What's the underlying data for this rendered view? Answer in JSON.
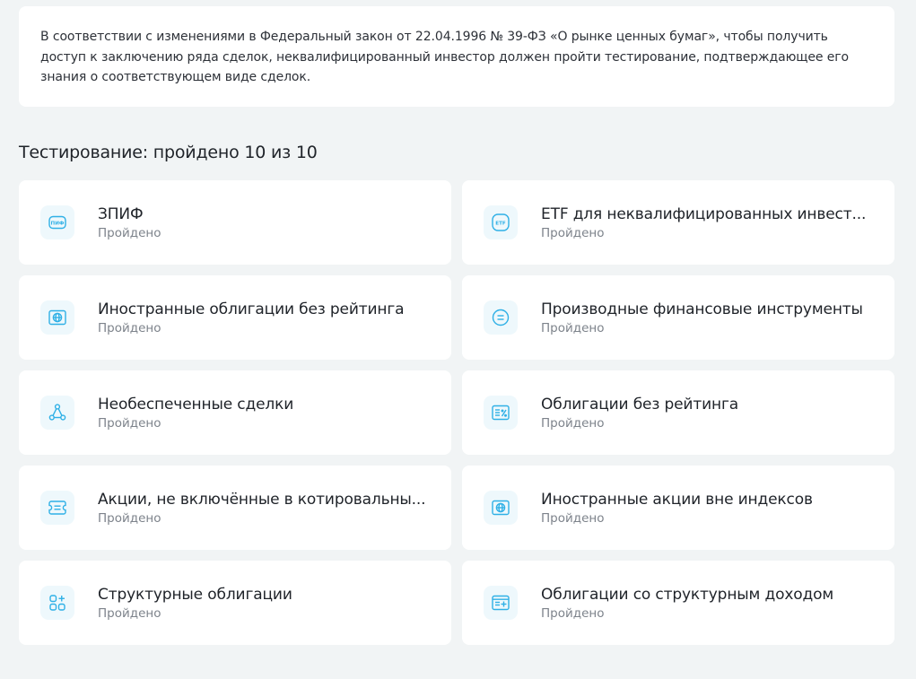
{
  "info": {
    "text": "В соответствии с изменениями в Федеральный закон от 22.04.1996 № 39-ФЗ «О рынке ценных бумаг», чтобы получить доступ к заключению ряда сделок, неквалифицированный инвестор должен пройти тестирование, подтверждающее его знания о соответствующем виде сделок."
  },
  "section": {
    "title": "Тестирование: пройдено 10 из 10"
  },
  "colors": {
    "accent": "#2fb0e6",
    "icon_bg": "#eef8fc",
    "page_bg": "#f1f4f5"
  },
  "tests": [
    {
      "title": "ЗПИФ",
      "status": "Пройдено",
      "icon": "pif-icon",
      "icon_text": "ПИФ"
    },
    {
      "title": "ETF для неквалифицированных инвест...",
      "status": "Пройдено",
      "icon": "etf-icon",
      "icon_text": "ETF"
    },
    {
      "title": "Иностранные облигации без рейтинга",
      "status": "Пройдено",
      "icon": "globe-icon"
    },
    {
      "title": "Производные финансовые инструменты",
      "status": "Пройдено",
      "icon": "coin-icon"
    },
    {
      "title": "Необеспеченные сделки",
      "status": "Пройдено",
      "icon": "nodes-icon"
    },
    {
      "title": "Облигации без рейтинга",
      "status": "Пройдено",
      "icon": "document-percent-icon"
    },
    {
      "title": "Акции, не включённые в котировальны...",
      "status": "Пройдено",
      "icon": "ticket-icon"
    },
    {
      "title": "Иностранные акции вне индексов",
      "status": "Пройдено",
      "icon": "globe-icon"
    },
    {
      "title": "Структурные облигации",
      "status": "Пройдено",
      "icon": "blocks-plus-icon"
    },
    {
      "title": "Облигации со структурным доходом",
      "status": "Пройдено",
      "icon": "document-plus-icon"
    }
  ]
}
